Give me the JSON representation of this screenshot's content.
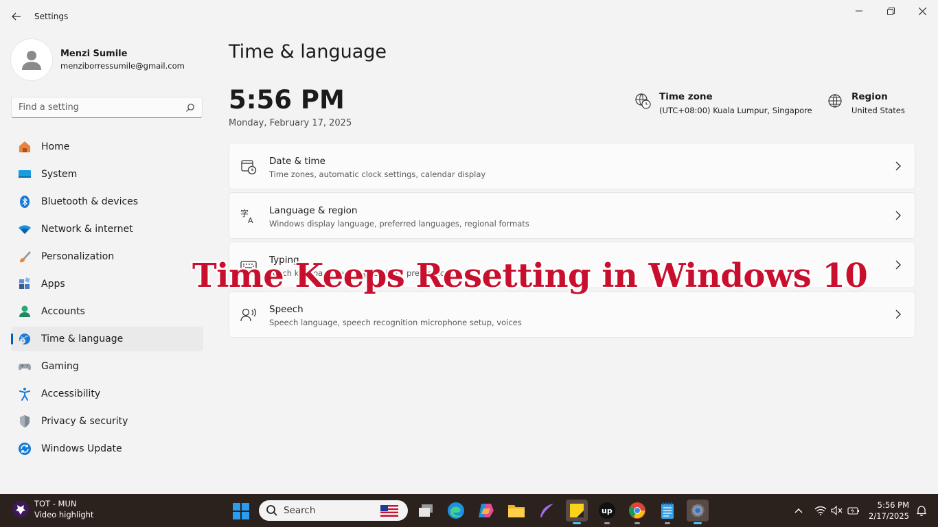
{
  "window": {
    "title": "Settings"
  },
  "profile": {
    "name": "Menzi Sumile",
    "email": "menziborressumile@gmail.com"
  },
  "search": {
    "placeholder": "Find a setting"
  },
  "sidebar": {
    "items": [
      {
        "label": "Home",
        "icon": "home-icon"
      },
      {
        "label": "System",
        "icon": "system-icon"
      },
      {
        "label": "Bluetooth & devices",
        "icon": "bluetooth-icon"
      },
      {
        "label": "Network & internet",
        "icon": "wifi-icon"
      },
      {
        "label": "Personalization",
        "icon": "brush-icon"
      },
      {
        "label": "Apps",
        "icon": "apps-icon"
      },
      {
        "label": "Accounts",
        "icon": "accounts-icon"
      },
      {
        "label": "Time & language",
        "icon": "globe-clock-icon",
        "active": true
      },
      {
        "label": "Gaming",
        "icon": "gamepad-icon"
      },
      {
        "label": "Accessibility",
        "icon": "accessibility-icon"
      },
      {
        "label": "Privacy & security",
        "icon": "shield-icon"
      },
      {
        "label": "Windows Update",
        "icon": "update-icon"
      }
    ]
  },
  "main": {
    "title": "Time & language",
    "time": "5:56 PM",
    "date": "Monday, February 17, 2025",
    "timezone": {
      "label": "Time zone",
      "value": "(UTC+08:00) Kuala Lumpur, Singapore"
    },
    "region": {
      "label": "Region",
      "value": "United States"
    },
    "cards": [
      {
        "title": "Date & time",
        "subtitle": "Time zones, automatic clock settings, calendar display",
        "icon": "calendar-clock-icon"
      },
      {
        "title": "Language & region",
        "subtitle": "Windows display language, preferred languages, regional formats",
        "icon": "language-icon"
      },
      {
        "title": "Typing",
        "subtitle": "Touch keyboard, text suggestions, preferences",
        "icon": "keyboard-icon"
      },
      {
        "title": "Speech",
        "subtitle": "Speech language, speech recognition microphone setup, voices",
        "icon": "speech-icon"
      }
    ]
  },
  "overlay": {
    "text": "Time Keeps Resetting in Windows 10",
    "color": "#c8102e"
  },
  "taskbar": {
    "widget": {
      "line1": "TOT - MUN",
      "line2": "Video highlight"
    },
    "search_label": "Search",
    "clock_time": "5:56 PM",
    "clock_date": "2/17/2025"
  },
  "colors": {
    "accent": "#005fb8",
    "taskbar": "#2b211d",
    "background": "#f3f3f3"
  }
}
